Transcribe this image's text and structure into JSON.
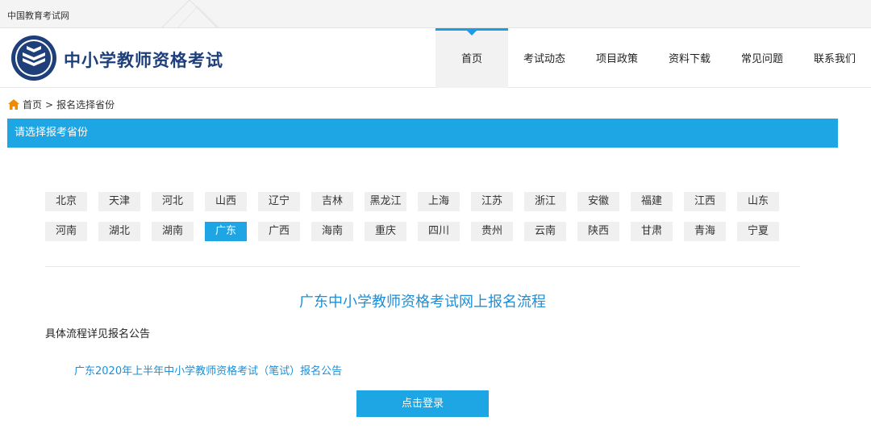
{
  "topbar": {
    "site_name": "中国教育考试网"
  },
  "header": {
    "brand": "中小学教师资格考试",
    "nav": [
      {
        "label": "首页",
        "active": true
      },
      {
        "label": "考试动态",
        "active": false
      },
      {
        "label": "项目政策",
        "active": false
      },
      {
        "label": "资料下载",
        "active": false
      },
      {
        "label": "常见问题",
        "active": false
      },
      {
        "label": "联系我们",
        "active": false
      }
    ]
  },
  "breadcrumb": {
    "home": "首页",
    "separator": ">",
    "current": "报名选择省份"
  },
  "banner": {
    "title": "请选择报考省份"
  },
  "provinces": {
    "selected": "广东",
    "rows": [
      [
        "北京",
        "天津",
        "河北",
        "山西",
        "辽宁",
        "吉林",
        "黑龙江",
        "上海",
        "江苏",
        "浙江",
        "安徽",
        "福建",
        "江西",
        "山东"
      ],
      [
        "河南",
        "湖北",
        "湖南",
        "广东",
        "广西",
        "海南",
        "重庆",
        "四川",
        "贵州",
        "云南",
        "陕西",
        "甘肃",
        "青海",
        "宁夏"
      ]
    ]
  },
  "flow": {
    "title": "广东中小学教师资格考试网上报名流程",
    "note": "具体流程详见报名公告",
    "notice_link": "广东2020年上半年中小学教师资格考试（笔试）报名公告",
    "login_button": "点击登录"
  },
  "colors": {
    "accent": "#1ea5e3",
    "link": "#1e8fd6",
    "brand": "#1f3f7a",
    "home_icon": "#f08a00"
  }
}
